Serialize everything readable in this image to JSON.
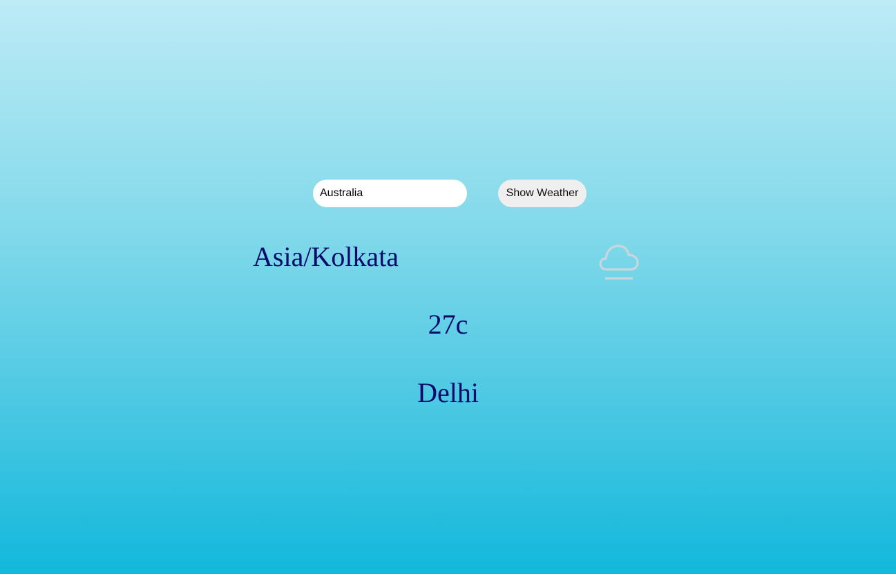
{
  "search": {
    "value": "Australia",
    "placeholder": ""
  },
  "button": {
    "label": "Show Weather"
  },
  "weather": {
    "timezone": "Asia/Kolkata",
    "temperature": "27c",
    "city": "Delhi",
    "icon": "cloud-fog-icon"
  },
  "colors": {
    "text": "#0a0a6b",
    "icon": "#c9d7dc",
    "background_top": "#bdebf6",
    "background_bottom": "#12b8dc"
  }
}
